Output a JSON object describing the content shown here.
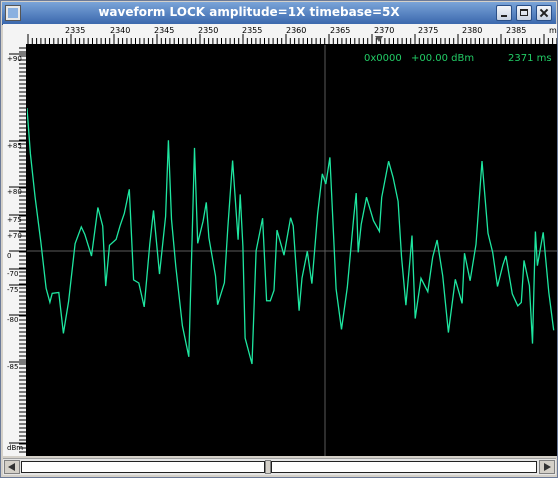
{
  "window": {
    "title": "waveform  LOCK amplitude=1X timebase=5X"
  },
  "controls": {
    "minimize": "minimize",
    "maximize": "maximize",
    "close": "close"
  },
  "ruler_top": {
    "labels": [
      "2335",
      "2340",
      "2345",
      "2350",
      "2355",
      "2360",
      "2365",
      "2370",
      "2375",
      "2380",
      "2385",
      "ms"
    ],
    "marker_label": "2370"
  },
  "ruler_left": {
    "labels": [
      "+90",
      "+85",
      "+80",
      "+75",
      "+70",
      "0",
      "-70",
      "-75",
      "-80",
      "-85",
      "dBm"
    ]
  },
  "readout": {
    "value": "0x0000",
    "level": "+00.00 dBm",
    "time": "2371 ms"
  },
  "colors": {
    "trace": "#1ee6a0",
    "readout": "#22cc66",
    "background": "#000000",
    "crosshair": "#5a5a5a"
  },
  "icons": {
    "window": "window-icon",
    "scroll_left": "arrow-left-icon",
    "scroll_right": "arrow-right-icon"
  }
}
